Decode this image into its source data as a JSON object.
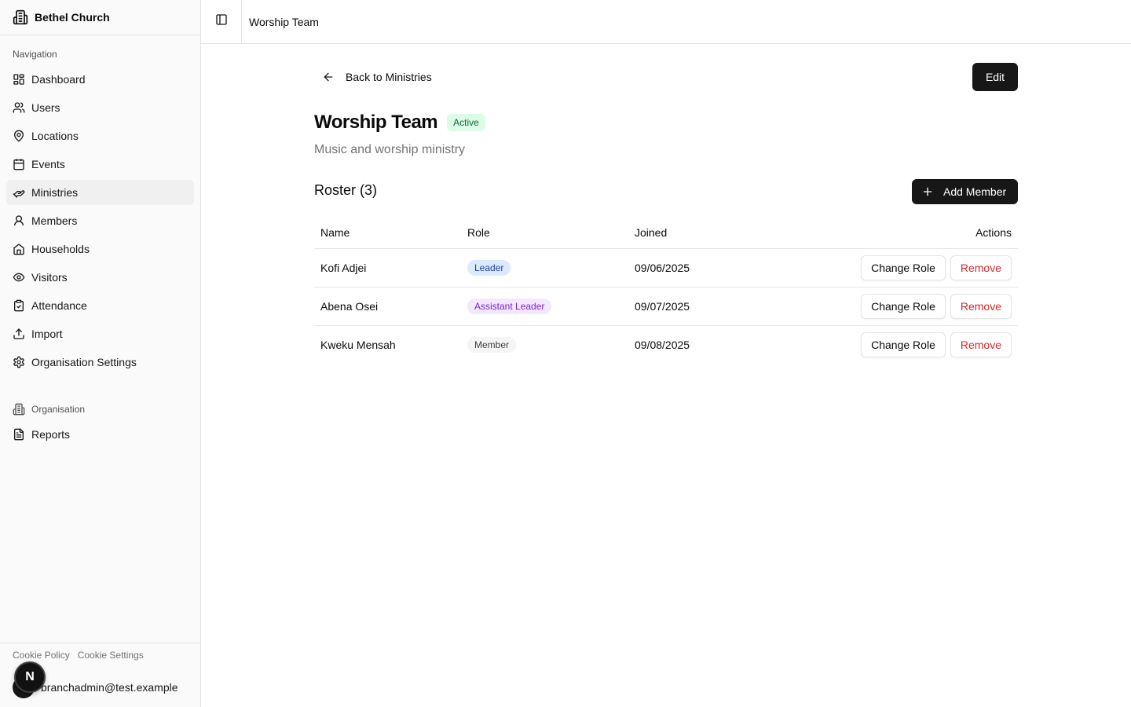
{
  "sidebar": {
    "brand": "Bethel Church",
    "nav_label": "Navigation",
    "items": [
      {
        "label": "Dashboard",
        "icon": "dashboard-icon"
      },
      {
        "label": "Users",
        "icon": "users-icon"
      },
      {
        "label": "Locations",
        "icon": "map-pin-icon"
      },
      {
        "label": "Events",
        "icon": "calendar-icon"
      },
      {
        "label": "Ministries",
        "icon": "hand-heart-icon",
        "active": true
      },
      {
        "label": "Members",
        "icon": "user-icon"
      },
      {
        "label": "Households",
        "icon": "house-icon"
      },
      {
        "label": "Visitors",
        "icon": "eye-icon"
      },
      {
        "label": "Attendance",
        "icon": "clipboard-check-icon"
      },
      {
        "label": "Import",
        "icon": "upload-icon"
      },
      {
        "label": "Organisation Settings",
        "icon": "gear-icon"
      }
    ],
    "org_label": "Organisation",
    "org_items": [
      {
        "label": "Reports",
        "icon": "file-text-icon"
      }
    ],
    "footer": {
      "cookie_policy": "Cookie Policy",
      "cookie_settings": "Cookie Settings",
      "user_email": "branchadmin@test.example"
    },
    "dev_badge": "N"
  },
  "header": {
    "breadcrumb": "Worship Team"
  },
  "main": {
    "back_label": "Back to Ministries",
    "edit_label": "Edit",
    "title": "Worship Team",
    "status": "Active",
    "description": "Music and worship ministry",
    "roster_title": "Roster (3)",
    "add_member_label": "Add Member",
    "columns": [
      "Name",
      "Role",
      "Joined",
      "Actions"
    ],
    "rows": [
      {
        "name": "Kofi Adjei",
        "role": "Leader",
        "joined": "09/06/2025"
      },
      {
        "name": "Abena Osei",
        "role": "Assistant Leader",
        "joined": "09/07/2025"
      },
      {
        "name": "Kweku Mensah",
        "role": "Member",
        "joined": "09/08/2025"
      }
    ],
    "change_role_label": "Change Role",
    "remove_label": "Remove"
  },
  "colors": {
    "primary": "#171717",
    "active_badge_bg": "#dcfce7",
    "active_badge_fg": "#166534",
    "leader_bg": "#dbeafe",
    "leader_fg": "#1e40af",
    "assistant_bg": "#f3e8ff",
    "assistant_fg": "#7e22ce",
    "member_bg": "#f5f5f5",
    "member_fg": "#404040",
    "danger": "#dc2626"
  }
}
